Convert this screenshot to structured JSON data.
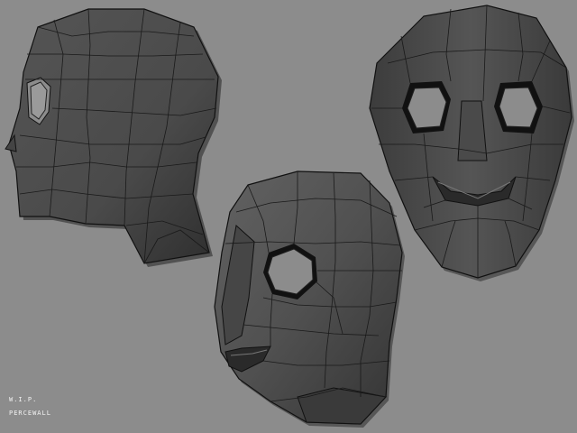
{
  "viewport": {
    "background": "#8c8c8c"
  },
  "models": [
    {
      "view": "side",
      "label": ""
    },
    {
      "view": "three-quarter",
      "label": ""
    },
    {
      "view": "front",
      "label": ""
    }
  ],
  "materials": {
    "shaded_dark": "#3a3a3a",
    "shaded_mid": "#555555",
    "shaded_light": "#6e6e6e",
    "wireframe": "#1a1a1a"
  },
  "caption": {
    "status": "W.I.P.",
    "author": "PERCEWALL"
  }
}
